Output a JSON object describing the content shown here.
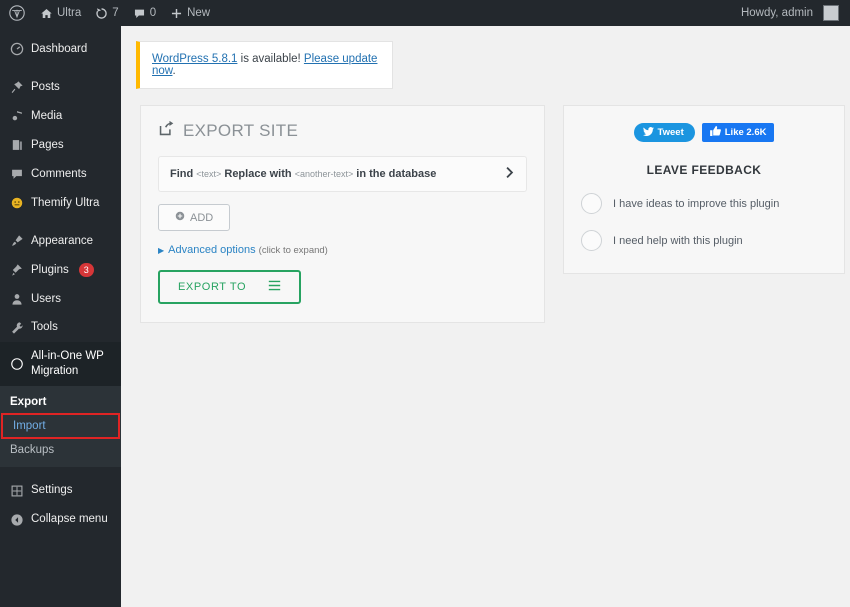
{
  "adminbar": {
    "wp_logo": "wordpress-logo-icon",
    "items": [
      {
        "icon": "home-icon",
        "label": "Ultra"
      },
      {
        "icon": "updates-icon",
        "label": "7"
      },
      {
        "icon": "comment-icon",
        "label": "0"
      },
      {
        "icon": "plus-icon",
        "label": "New"
      }
    ],
    "howdy": "Howdy, admin"
  },
  "sidebar": {
    "items": [
      {
        "label": "Dashboard",
        "icon": "dashboard-icon"
      },
      {
        "label": "Posts",
        "icon": "pin-icon"
      },
      {
        "label": "Media",
        "icon": "media-icon"
      },
      {
        "label": "Pages",
        "icon": "pages-icon"
      },
      {
        "label": "Comments",
        "icon": "comment-icon"
      },
      {
        "label": "Themify Ultra",
        "icon": "themify-icon"
      },
      {
        "label": "Appearance",
        "icon": "brush-icon"
      },
      {
        "label": "Plugins",
        "icon": "plugin-icon",
        "badge": "3"
      },
      {
        "label": "Users",
        "icon": "users-icon"
      },
      {
        "label": "Tools",
        "icon": "tools-icon"
      },
      {
        "label": "All-in-One WP Migration",
        "icon": "migration-icon"
      },
      {
        "label": "Settings",
        "icon": "settings-icon"
      },
      {
        "label": "Collapse menu",
        "icon": "collapse-icon"
      }
    ],
    "submenu": [
      {
        "label": "Export",
        "state": "current"
      },
      {
        "label": "Import",
        "state": "highlighted"
      },
      {
        "label": "Backups",
        "state": "normal"
      }
    ]
  },
  "notice": {
    "link_version": "WordPress 5.8.1",
    "middle": " is available! ",
    "link_update": "Please update now",
    "period": "."
  },
  "export_panel": {
    "icon": "export-share-icon",
    "title": "EXPORT SITE",
    "findreplace": {
      "find_label": "Find",
      "find_value": "<text>",
      "replace_label": "Replace with",
      "replace_value": "<another-text>",
      "suffix": "in the database",
      "chevron": "chevron-right-icon"
    },
    "add_button": "ADD",
    "add_icon": "plus-circle-icon",
    "advanced_label": "Advanced options",
    "advanced_hint": "(click to expand)",
    "export_to_label": "EXPORT TO",
    "export_to_icon": "hamburger-menu-icon",
    "accent_green": "#27a361"
  },
  "feedback_panel": {
    "tweet_label": "Tweet",
    "tweet_icon": "twitter-bird-icon",
    "tweet_color": "#1b95e0",
    "like_label": "Like 2.6K",
    "like_icon": "thumbs-up-icon",
    "like_color": "#1877f2",
    "title": "LEAVE FEEDBACK",
    "options": [
      {
        "label": "I have ideas to improve this plugin"
      },
      {
        "label": "I need help with this plugin"
      }
    ]
  }
}
